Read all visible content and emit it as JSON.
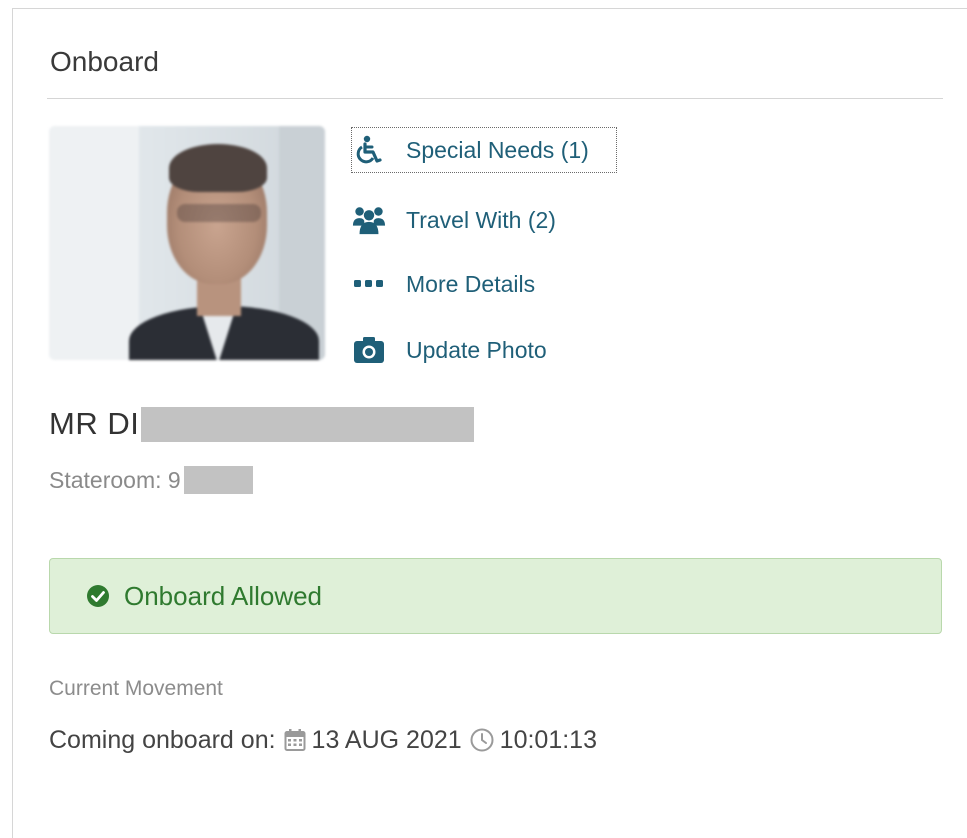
{
  "panel": {
    "title": "Onboard"
  },
  "actions": [
    {
      "label": "Special Needs (1)",
      "icon": "wheelchair-icon"
    },
    {
      "label": "Travel With (2)",
      "icon": "users-icon"
    },
    {
      "label": "More Details",
      "icon": "ellipsis-icon"
    },
    {
      "label": "Update Photo",
      "icon": "camera-icon"
    }
  ],
  "guest": {
    "name_prefix": "MR DI",
    "stateroom_prefix": "Stateroom: 9"
  },
  "status": {
    "text": "Onboard Allowed",
    "icon": "check-circle-icon",
    "color": "#2f7a2f"
  },
  "movement": {
    "label": "Current Movement",
    "prefix": "Coming onboard on:",
    "date": "13 AUG 2021",
    "time": "10:01:13"
  },
  "colors": {
    "link": "#1f5f78",
    "alert_bg": "#dff0d8"
  }
}
